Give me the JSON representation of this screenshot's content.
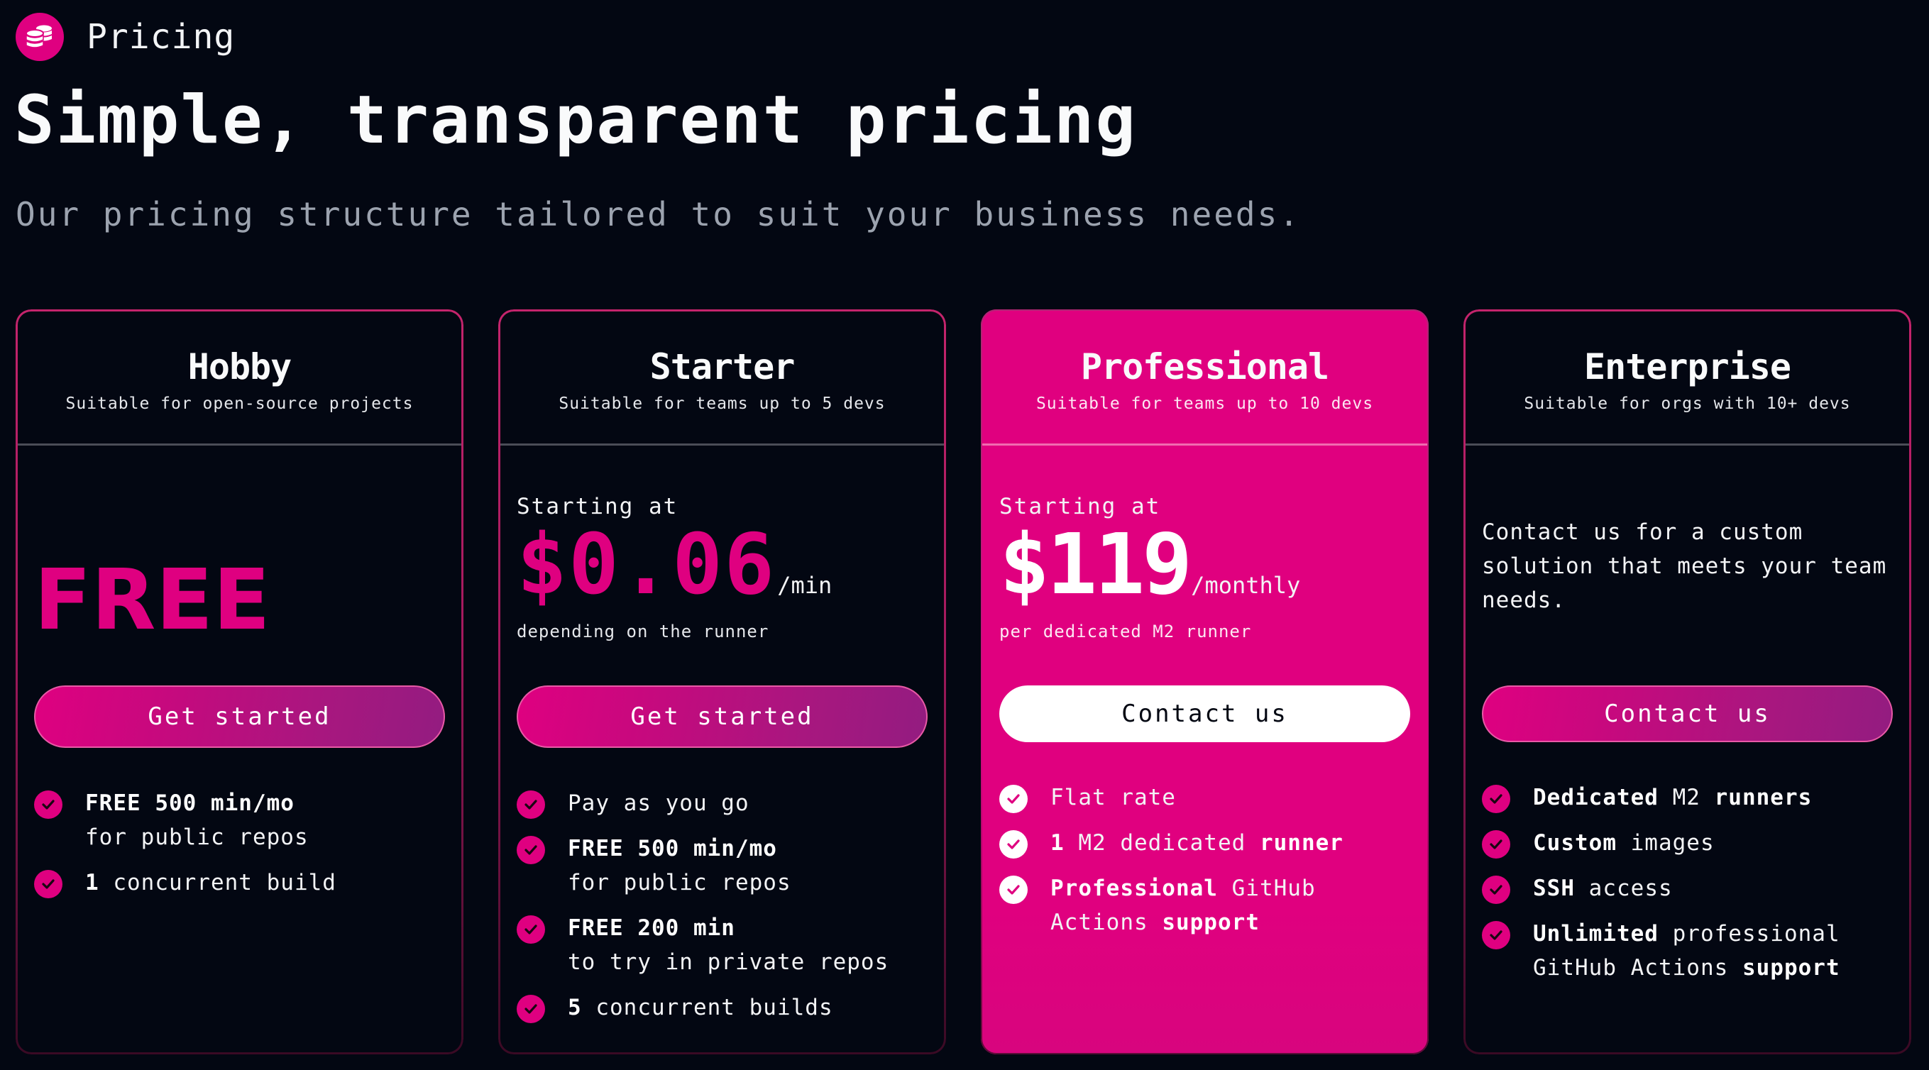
{
  "brand": {
    "label": "Pricing",
    "icon": "coins-icon"
  },
  "hero": {
    "title": "Simple, transparent pricing",
    "subtitle": "Our pricing structure tailored to suit your business needs."
  },
  "colors": {
    "accent": "#df0080",
    "accent_gradient_end": "#931c80",
    "background": "#030712",
    "muted_text": "#9ca3af"
  },
  "plans": [
    {
      "name": "Hobby",
      "description": "Suitable for open-source projects",
      "price": "FREE",
      "cta": "Get started",
      "features": [
        {
          "strong": "FREE 500 min/mo",
          "rest": "for public repos",
          "break": true
        },
        {
          "strong": "1",
          "rest": " concurrent build"
        }
      ]
    },
    {
      "name": "Starter",
      "description": "Suitable for teams up to 5 devs",
      "starting_at": "Starting at",
      "price": "$0.06",
      "unit": "/min",
      "note": "depending on the runner",
      "cta": "Get started",
      "features": [
        {
          "strong": "",
          "rest": "Pay as you go"
        },
        {
          "strong": "FREE 500 min/mo",
          "rest": "for public repos",
          "break": true
        },
        {
          "strong": "FREE 200 min",
          "rest": "to try in private repos",
          "break": true
        },
        {
          "strong": "5",
          "rest": " concurrent builds"
        }
      ]
    },
    {
      "name": "Professional",
      "description": "Suitable for teams up to 10 devs",
      "starting_at": "Starting at",
      "price": "$119",
      "unit": "/monthly",
      "note": "per dedicated M2 runner",
      "cta": "Contact us",
      "featured": true,
      "features": [
        {
          "parts": [
            [
              "",
              "Flat rate"
            ]
          ]
        },
        {
          "parts": [
            [
              "b",
              "1"
            ],
            [
              "",
              " M2 dedicated "
            ],
            [
              "b",
              "runner"
            ]
          ]
        },
        {
          "parts": [
            [
              "b",
              "Professional"
            ],
            [
              "",
              " GitHub Actions "
            ],
            [
              "b",
              "support"
            ]
          ]
        }
      ]
    },
    {
      "name": "Enterprise",
      "description": "Suitable for orgs with 10+ devs",
      "blurb": "Contact us for a custom solution that meets your team needs.",
      "cta": "Contact us",
      "features": [
        {
          "parts": [
            [
              "b",
              "Dedicated"
            ],
            [
              "",
              " M2 "
            ],
            [
              "b",
              "runners"
            ]
          ]
        },
        {
          "parts": [
            [
              "b",
              "Custom"
            ],
            [
              "",
              " images"
            ]
          ]
        },
        {
          "parts": [
            [
              "b",
              "SSH"
            ],
            [
              "",
              " access"
            ]
          ]
        },
        {
          "parts": [
            [
              "b",
              "Unlimited"
            ],
            [
              "",
              " professional GitHub Actions "
            ],
            [
              "b",
              "support"
            ]
          ]
        }
      ]
    }
  ]
}
